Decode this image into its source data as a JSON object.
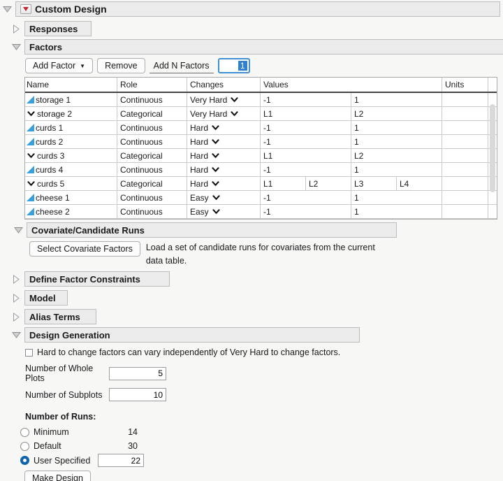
{
  "title": {
    "text": "Custom Design"
  },
  "icons": {
    "caret_down": "▼"
  },
  "responses": {
    "label": "Responses"
  },
  "factors": {
    "label": "Factors",
    "toolbar": {
      "add_factor": "Add Factor",
      "remove": "Remove",
      "add_n_label": "Add N Factors",
      "add_n_value": "1"
    },
    "table": {
      "headers": [
        "Name",
        "Role",
        "Changes",
        "Values",
        "Units"
      ],
      "rows": [
        {
          "type": "continuous",
          "name": "storage 1",
          "role": "Continuous",
          "changes": "Very Hard",
          "values": [
            "-1",
            "1"
          ],
          "units": ""
        },
        {
          "type": "categorical",
          "name": "storage 2",
          "role": "Categorical",
          "changes": "Very Hard",
          "values": [
            "L1",
            "L2"
          ],
          "units": ""
        },
        {
          "type": "continuous",
          "name": "curds 1",
          "role": "Continuous",
          "changes": "Hard",
          "values": [
            "-1",
            "1"
          ],
          "units": ""
        },
        {
          "type": "continuous",
          "name": "curds 2",
          "role": "Continuous",
          "changes": "Hard",
          "values": [
            "-1",
            "1"
          ],
          "units": ""
        },
        {
          "type": "categorical",
          "name": "curds 3",
          "role": "Categorical",
          "changes": "Hard",
          "values": [
            "L1",
            "L2"
          ],
          "units": ""
        },
        {
          "type": "continuous",
          "name": "curds 4",
          "role": "Continuous",
          "changes": "Hard",
          "values": [
            "-1",
            "1"
          ],
          "units": ""
        },
        {
          "type": "categorical",
          "name": "curds 5",
          "role": "Categorical",
          "changes": "Hard",
          "values": [
            "L1",
            "L2",
            "L3",
            "L4"
          ],
          "units": ""
        },
        {
          "type": "continuous",
          "name": "cheese 1",
          "role": "Continuous",
          "changes": "Easy",
          "values": [
            "-1",
            "1"
          ],
          "units": ""
        },
        {
          "type": "continuous",
          "name": "cheese 2",
          "role": "Continuous",
          "changes": "Easy",
          "values": [
            "-1",
            "1"
          ],
          "units": ""
        }
      ]
    }
  },
  "covariate": {
    "label": "Covariate/Candidate Runs",
    "button": "Select Covariate Factors",
    "description_lines": [
      "Load a set of candidate runs for covariates from the current",
      "data table."
    ]
  },
  "define_constraints": {
    "label": "Define Factor Constraints"
  },
  "model": {
    "label": "Model"
  },
  "alias": {
    "label": "Alias Terms"
  },
  "design_generation": {
    "label": "Design Generation",
    "checkbox_label": "Hard to change factors can vary independently of Very Hard to change factors.",
    "checkbox_checked": false,
    "whole_plots_label": "Number of Whole Plots",
    "whole_plots_value": "5",
    "subplots_label": "Number of Subplots",
    "subplots_value": "10",
    "runs_title": "Number of Runs:",
    "runs_minimum_label": "Minimum",
    "runs_minimum_value": "14",
    "runs_default_label": "Default",
    "runs_default_value": "30",
    "runs_user_label": "User Specified",
    "runs_user_value": "22",
    "selected_option": "User Specified"
  },
  "make_design": {
    "label": "Make Design"
  },
  "colors": {
    "accent_blue": "#0f64ab",
    "icon_blue": "#38a0dc",
    "selection_blue": "#2f80d0",
    "field_focus_border": "#3f8fd2",
    "header_band": "#ebebeb",
    "red_triangle": "#c8252c"
  }
}
